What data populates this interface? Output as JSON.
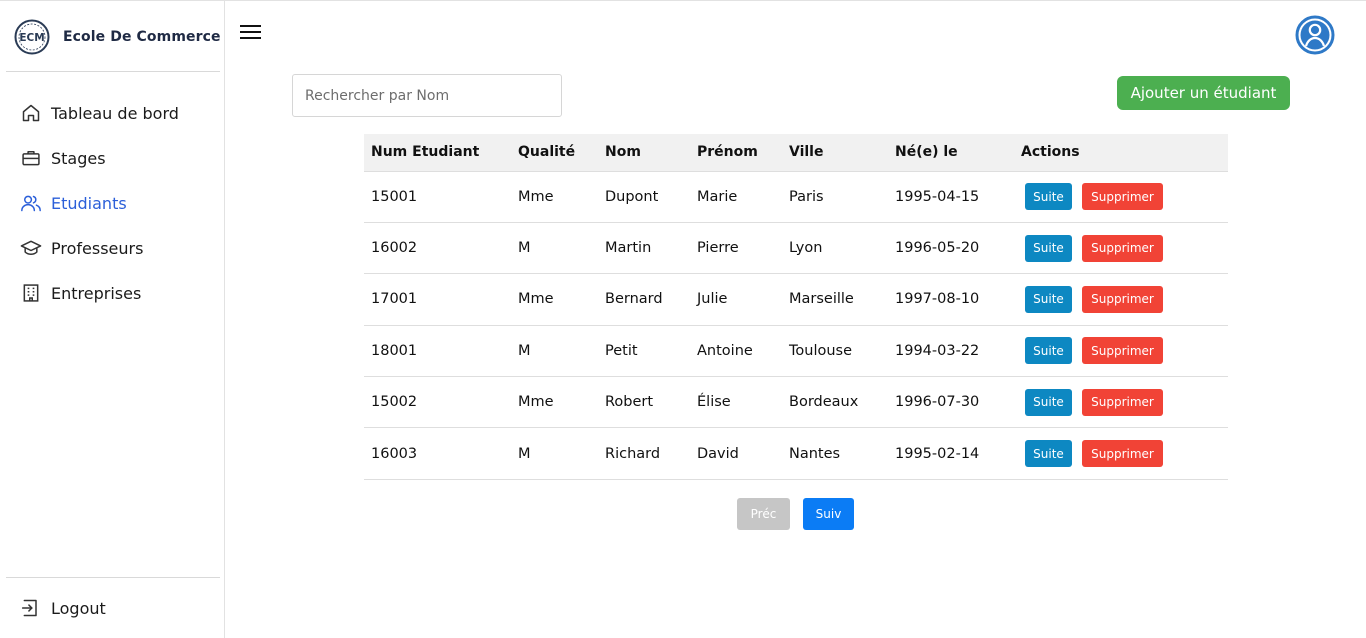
{
  "brand": {
    "logo_text": "ECM",
    "name": "Ecole De Commerce"
  },
  "sidebar": {
    "items": [
      {
        "label": "Tableau de bord",
        "icon": "home-icon",
        "active": false
      },
      {
        "label": "Stages",
        "icon": "briefcase-icon",
        "active": false
      },
      {
        "label": "Etudiants",
        "icon": "users-icon",
        "active": true
      },
      {
        "label": "Professeurs",
        "icon": "graduation-cap-icon",
        "active": false
      },
      {
        "label": "Entreprises",
        "icon": "building-icon",
        "active": false
      }
    ],
    "logout_label": "Logout"
  },
  "header": {
    "menu_icon": "hamburger-icon",
    "avatar_icon": "user-avatar-icon"
  },
  "search": {
    "placeholder": "Rechercher par Nom",
    "value": ""
  },
  "add_button_label": "Ajouter un étudiant",
  "table": {
    "headers": [
      "Num Etudiant",
      "Qualité",
      "Nom",
      "Prénom",
      "Ville",
      "Né(e) le",
      "Actions"
    ],
    "rows": [
      {
        "num": "15001",
        "qualite": "Mme",
        "nom": "Dupont",
        "prenom": "Marie",
        "ville": "Paris",
        "naissance": "1995-04-15"
      },
      {
        "num": "16002",
        "qualite": "M",
        "nom": "Martin",
        "prenom": "Pierre",
        "ville": "Lyon",
        "naissance": "1996-05-20"
      },
      {
        "num": "17001",
        "qualite": "Mme",
        "nom": "Bernard",
        "prenom": "Julie",
        "ville": "Marseille",
        "naissance": "1997-08-10"
      },
      {
        "num": "18001",
        "qualite": "M",
        "nom": "Petit",
        "prenom": "Antoine",
        "ville": "Toulouse",
        "naissance": "1994-03-22"
      },
      {
        "num": "15002",
        "qualite": "Mme",
        "nom": "Robert",
        "prenom": "Élise",
        "ville": "Bordeaux",
        "naissance": "1996-07-30"
      },
      {
        "num": "16003",
        "qualite": "M",
        "nom": "Richard",
        "prenom": "David",
        "ville": "Nantes",
        "naissance": "1995-02-14"
      }
    ],
    "actions": {
      "suite_label": "Suite",
      "delete_label": "Supprimer"
    }
  },
  "pagination": {
    "prev_label": "Préc",
    "next_label": "Suiv"
  },
  "colors": {
    "active_nav": "#2b5fd9",
    "add_button": "#4caf50",
    "suite_button": "#0d88c2",
    "delete_button": "#f14336",
    "next_button": "#0b7cf5",
    "prev_button_disabled": "#c6c6c6"
  }
}
